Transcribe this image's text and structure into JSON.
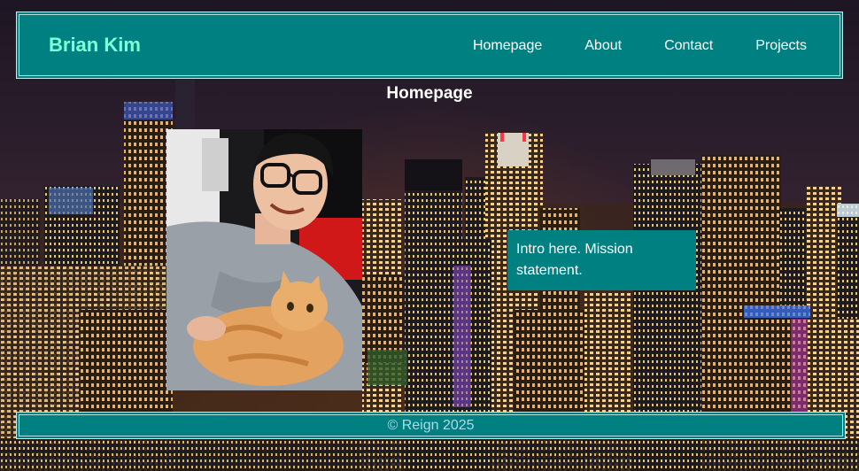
{
  "header": {
    "brand": "Brian Kim",
    "nav": [
      {
        "label": "Homepage"
      },
      {
        "label": "About"
      },
      {
        "label": "Contact"
      },
      {
        "label": "Projects"
      }
    ]
  },
  "main": {
    "title": "Homepage",
    "intro": "Intro here. Mission statement."
  },
  "footer": {
    "text": "© Reign 2025"
  },
  "colors": {
    "accent": "#008080",
    "brand_text": "#7fffd4",
    "footer_text": "#a9dcea"
  }
}
